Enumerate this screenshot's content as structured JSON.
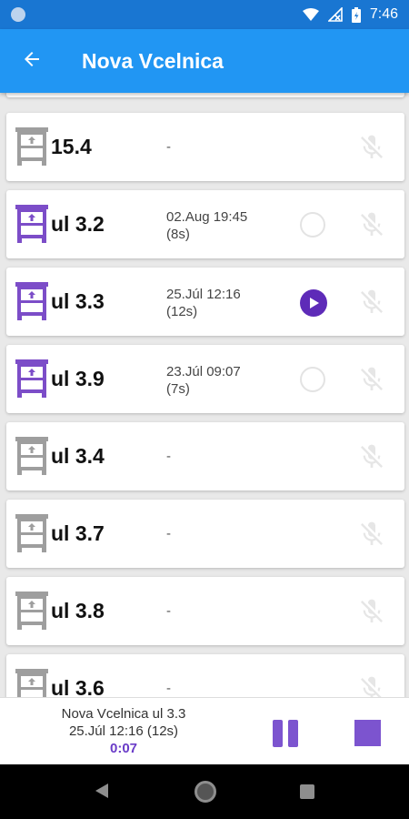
{
  "status_bar": {
    "time": "7:46",
    "icons": [
      "status-circle-icon",
      "wifi-icon",
      "signal-off-icon",
      "battery-icon"
    ]
  },
  "app_bar": {
    "title": "Nova Vcelnica",
    "back_icon": "arrow-left-icon"
  },
  "colors": {
    "primary": "#2196f3",
    "primary_dark": "#1976d2",
    "accent_purple": "#5e2bb8",
    "hive_active": "#7c4dc8",
    "hive_inactive": "#9e9e9e"
  },
  "hives": [
    {
      "name": "15.4",
      "active": false,
      "last_recording": "-",
      "duration": "",
      "state": "none"
    },
    {
      "name": "ul 3.2",
      "active": true,
      "last_recording": "02.Aug 19:45",
      "duration": "(8s)",
      "state": "idle"
    },
    {
      "name": "ul 3.3",
      "active": true,
      "last_recording": "25.Júl 12:16",
      "duration": "(12s)",
      "state": "playing"
    },
    {
      "name": "ul 3.9",
      "active": true,
      "last_recording": "23.Júl 09:07",
      "duration": "(7s)",
      "state": "idle"
    },
    {
      "name": "ul 3.4",
      "active": false,
      "last_recording": "-",
      "duration": "",
      "state": "none"
    },
    {
      "name": "ul 3.7",
      "active": false,
      "last_recording": "-",
      "duration": "",
      "state": "none"
    },
    {
      "name": "ul 3.8",
      "active": false,
      "last_recording": "-",
      "duration": "",
      "state": "none"
    },
    {
      "name": "ul 3.6",
      "active": false,
      "last_recording": "-",
      "duration": "",
      "state": "none"
    }
  ],
  "player": {
    "title": "Nova Vcelnica ul 3.3",
    "subtitle": "25.Júl 12:16 (12s)",
    "position": "0:07",
    "pause_icon": "pause-icon",
    "stop_icon": "stop-icon"
  },
  "nav_bar": {
    "icons": [
      "nav-back-icon",
      "nav-home-icon",
      "nav-recents-icon"
    ]
  }
}
